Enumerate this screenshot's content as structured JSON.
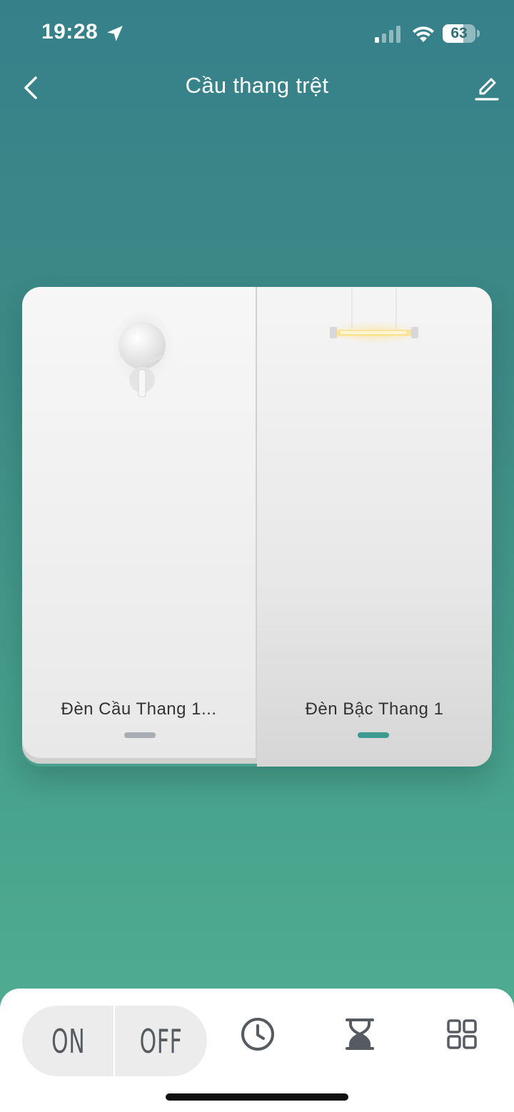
{
  "status_bar": {
    "time": "19:28",
    "battery_level": "63",
    "battery_fraction": 0.63
  },
  "header": {
    "title": "Cầu thang trệt",
    "back_icon": "chevron-left-icon",
    "edit_icon": "pencil-icon"
  },
  "switches": [
    {
      "label": "Đèn Cầu Thang 1...",
      "state": "off",
      "icon": "wall-lamp-icon"
    },
    {
      "label": "Đèn Bậc Thang 1",
      "state": "on",
      "icon": "tube-light-icon"
    }
  ],
  "toolbar": {
    "on_label": "ON",
    "off_label": "OFF",
    "schedule_icon": "clock-icon",
    "timer_icon": "hourglass-icon",
    "more_icon": "grid-icon"
  },
  "colors": {
    "background_top": "#36808a",
    "background_bottom": "#52b093",
    "indicator_on": "#3d9a8e",
    "indicator_off": "#a9adb1"
  }
}
